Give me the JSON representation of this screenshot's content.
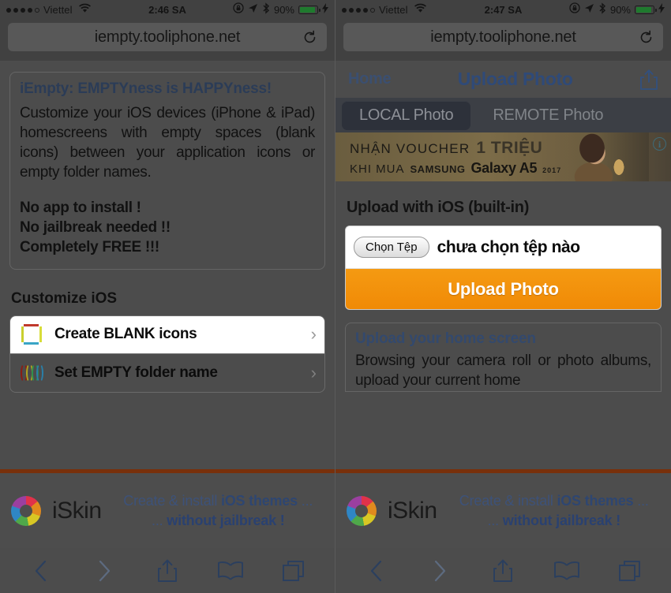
{
  "phones": [
    {
      "id": "left",
      "status": {
        "carrier": "Viettel",
        "signal_dots_filled": 4,
        "signal_dots_total": 5,
        "time": "2:46 SA",
        "battery_pct": "90%",
        "wifi_icon": "wifi-icon",
        "lock_rotation_icon": "rotation-lock-icon",
        "location_icon": "location-arrow-icon",
        "bluetooth_icon": "bluetooth-icon",
        "charging_icon": "charging-bolt-icon"
      },
      "url": "iempty.tooliphone.net",
      "reload_icon": "reload-icon"
    },
    {
      "id": "right",
      "status": {
        "carrier": "Viettel",
        "signal_dots_filled": 4,
        "signal_dots_total": 5,
        "time": "2:47 SA",
        "battery_pct": "90%",
        "wifi_icon": "wifi-icon",
        "lock_rotation_icon": "rotation-lock-icon",
        "location_icon": "location-arrow-icon",
        "bluetooth_icon": "bluetooth-icon",
        "charging_icon": "charging-bolt-icon"
      },
      "url": "iempty.tooliphone.net",
      "reload_icon": "reload-icon"
    }
  ],
  "left_page": {
    "info": {
      "heading": "iEmpty: EMPTYness is HAPPYness!",
      "body": "Customize your iOS devices (iPhone & iPad) homescreens with empty spaces (blank icons) between your application icons or empty folder names.",
      "bullets": [
        "No app to install !",
        "No jailbreak needed !!",
        "Completely FREE !!!"
      ]
    },
    "section_title": "Customize iOS",
    "menu": [
      {
        "label": "Create BLANK icons",
        "icon": "blank-icon-glyph",
        "chevron": "›",
        "selected": true
      },
      {
        "label": "Set EMPTY folder name",
        "icon": "folder-parens-glyph",
        "chevron": "›",
        "selected": false
      }
    ]
  },
  "right_page": {
    "nav": {
      "home": "Home",
      "title": "Upload Photo",
      "share_icon": "share-icon"
    },
    "segments": [
      {
        "label": "LOCAL Photo",
        "selected": true
      },
      {
        "label": "REMOTE Photo",
        "selected": false
      }
    ],
    "ad": {
      "line1_prefix": "NHẬN VOUCHER",
      "line1_big": "1 TRIỆU",
      "line2_prefix": "KHI MUA",
      "line2_brand": "SAMSUNG",
      "line2_model": "Galaxy A5",
      "line2_year": "2017",
      "info_badge": "i"
    },
    "upload_title": "Upload with iOS (built-in)",
    "file_button": "Chọn Tệp",
    "file_status": "chưa chọn tệp nào",
    "upload_button": "Upload Photo",
    "note": {
      "heading": "Upload your home screen",
      "body": "Browsing your camera roll or photo albums, upload your current home"
    }
  },
  "bottom_ad": {
    "brand": "iSkin",
    "logo_icon": "iskin-pinwheel-logo",
    "line1_plain": "Create & install ",
    "line1_bold": "iOS themes",
    "line1_suffix": " ...",
    "line2_prefix": "... ",
    "line2_bold": "without jailbreak !"
  },
  "toolbar": {
    "items": [
      {
        "icon": "back-chevron-icon",
        "enabled": true
      },
      {
        "icon": "forward-chevron-icon",
        "enabled": false
      },
      {
        "icon": "share-icon",
        "enabled": true
      },
      {
        "icon": "bookmarks-book-icon",
        "enabled": true
      },
      {
        "icon": "tabs-icon",
        "enabled": true
      }
    ]
  },
  "colors": {
    "page_bg": "#4c4c4c",
    "chrome_bg": "#414141",
    "accent_blue": "#2f4a78",
    "upload_orange": "#f28c0a",
    "divider_brown": "#78300b",
    "segment_selected": "#2d313a"
  }
}
